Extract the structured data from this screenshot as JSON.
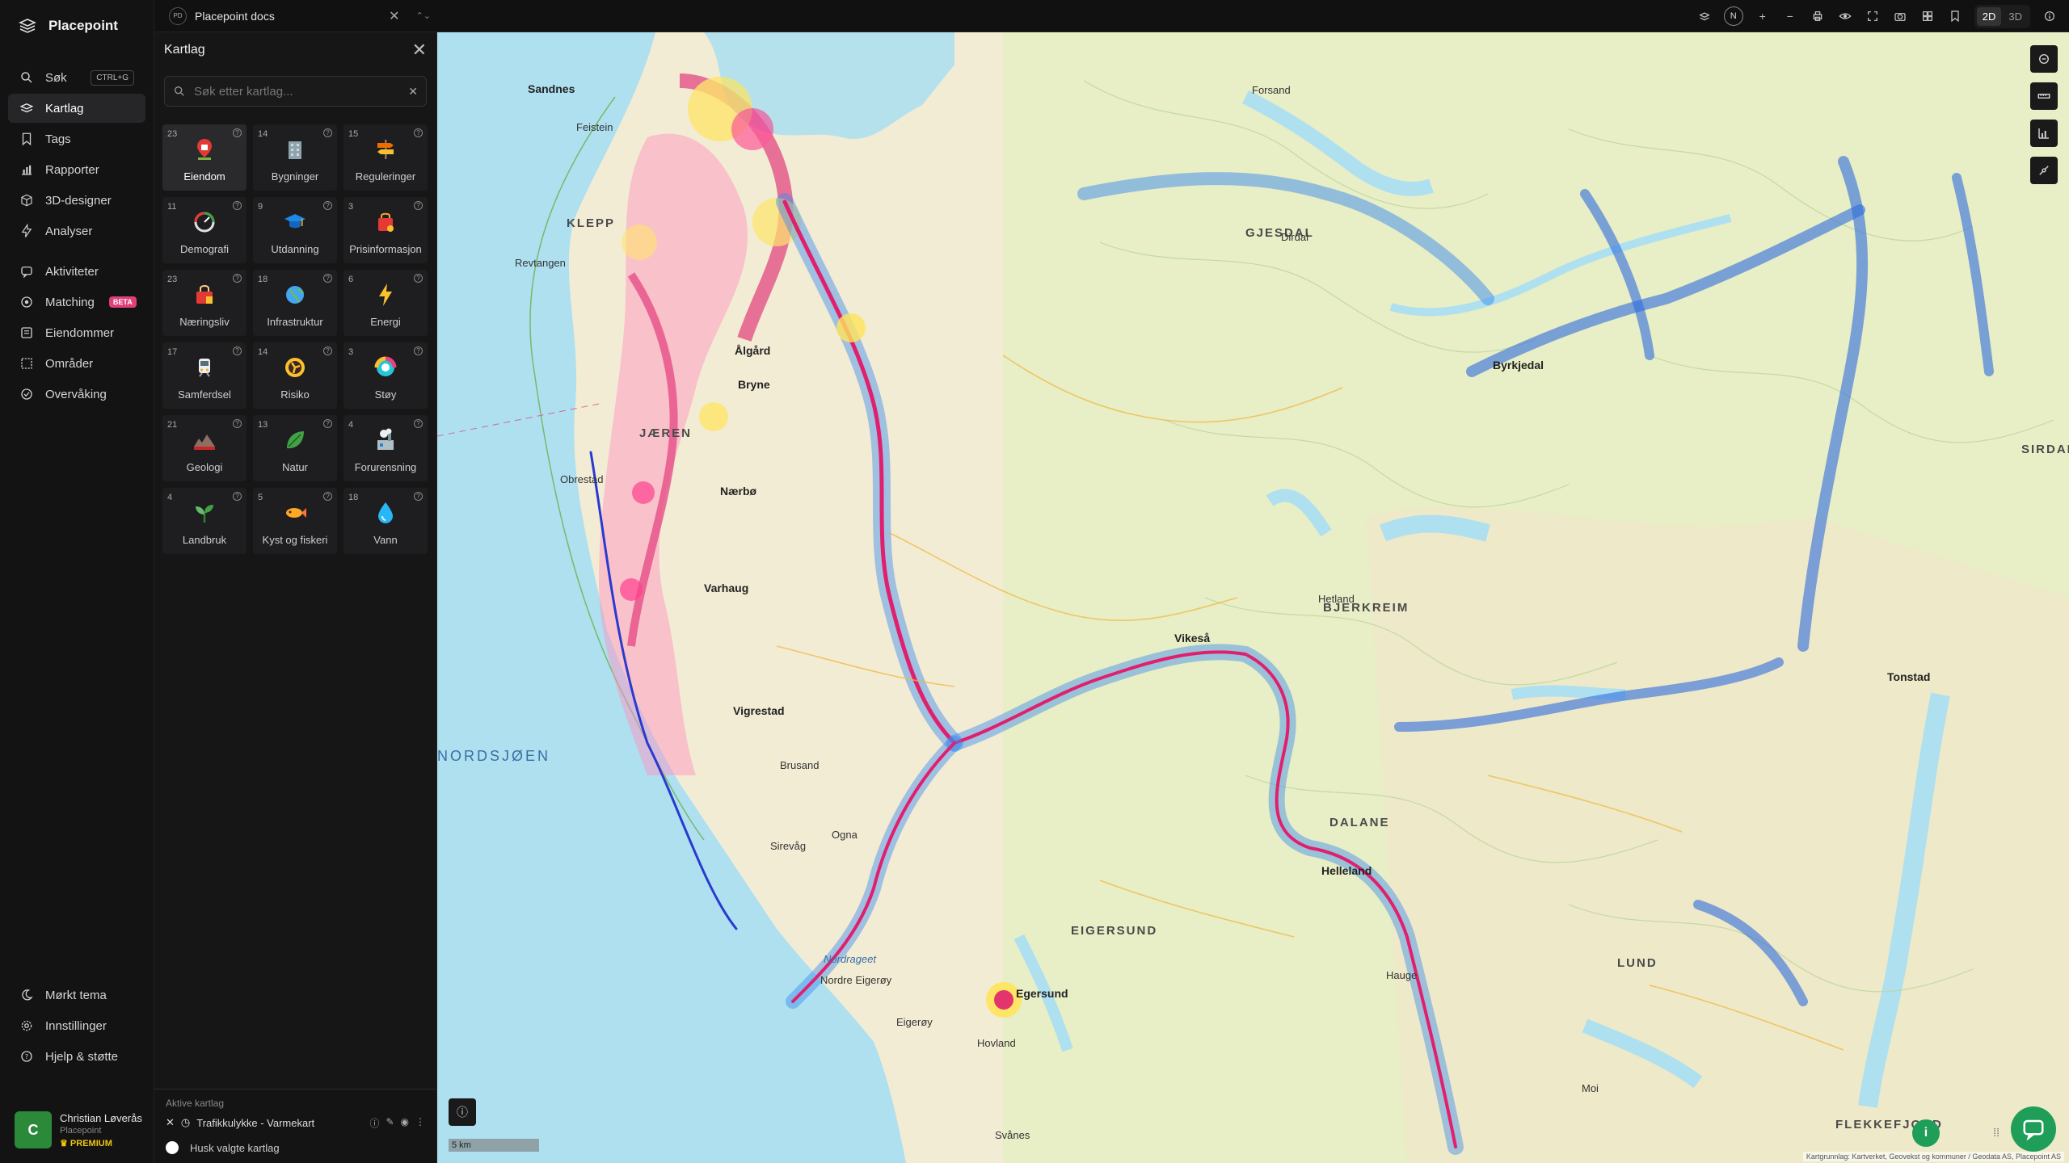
{
  "brand": {
    "name": "Placepoint"
  },
  "nav": {
    "primary": [
      {
        "label": "Søk",
        "shortcut": "CTRL+G"
      },
      {
        "label": "Kartlag"
      },
      {
        "label": "Tags"
      },
      {
        "label": "Rapporter"
      },
      {
        "label": "3D-designer"
      },
      {
        "label": "Analyser"
      }
    ],
    "secondary": [
      {
        "label": "Aktiviteter"
      },
      {
        "label": "Matching",
        "badge": "BETA"
      },
      {
        "label": "Eiendommer"
      },
      {
        "label": "Områder"
      },
      {
        "label": "Overvåking"
      }
    ],
    "bottom": [
      {
        "label": "Mørkt tema"
      },
      {
        "label": "Innstillinger"
      },
      {
        "label": "Hjelp & støtte"
      }
    ]
  },
  "user": {
    "initial": "C",
    "name": "Christian Løverås",
    "org": "Placepoint",
    "tier": "PREMIUM"
  },
  "topbar": {
    "doc_badge": "PD",
    "doc_title": "Placepoint docs",
    "compass": "N",
    "view_2d": "2D",
    "view_3d": "3D"
  },
  "panel": {
    "title": "Kartlag",
    "search_placeholder": "Søk etter kartlag...",
    "tiles": [
      {
        "count": "23",
        "label": "Eiendom",
        "icon": "pin-house-icon",
        "selected": true
      },
      {
        "count": "14",
        "label": "Bygninger",
        "icon": "building-icon"
      },
      {
        "count": "15",
        "label": "Reguleringer",
        "icon": "signpost-icon"
      },
      {
        "count": "11",
        "label": "Demografi",
        "icon": "gauge-icon"
      },
      {
        "count": "9",
        "label": "Utdanning",
        "icon": "graduation-cap-icon"
      },
      {
        "count": "3",
        "label": "Prisinformasjon",
        "icon": "shopping-bag-icon"
      },
      {
        "count": "23",
        "label": "Næringsliv",
        "icon": "shop-bag-icon"
      },
      {
        "count": "18",
        "label": "Infrastruktur",
        "icon": "globe-icon"
      },
      {
        "count": "6",
        "label": "Energi",
        "icon": "lightning-icon"
      },
      {
        "count": "17",
        "label": "Samferdsel",
        "icon": "train-icon"
      },
      {
        "count": "14",
        "label": "Risiko",
        "icon": "hazard-icon"
      },
      {
        "count": "3",
        "label": "Støy",
        "icon": "noise-dial-icon"
      },
      {
        "count": "21",
        "label": "Geologi",
        "icon": "terrain-icon"
      },
      {
        "count": "13",
        "label": "Natur",
        "icon": "leaf-icon"
      },
      {
        "count": "4",
        "label": "Forurensning",
        "icon": "factory-icon"
      },
      {
        "count": "4",
        "label": "Landbruk",
        "icon": "sprout-icon"
      },
      {
        "count": "5",
        "label": "Kyst og fiskeri",
        "icon": "fish-icon"
      },
      {
        "count": "18",
        "label": "Vann",
        "icon": "water-drop-icon"
      }
    ],
    "active_title": "Aktive kartlag",
    "active_layers": [
      {
        "label": "Trafikkulykke - Varmekart"
      }
    ],
    "remember_label": "Husk valgte kartlag"
  },
  "map": {
    "labels": {
      "sandnes": "Sandnes",
      "klepp": "KLEPP",
      "jaeren": "JÆREN",
      "bryne": "Bryne",
      "naerbo": "Nærbø",
      "varhaug": "Varhaug",
      "vigrestad": "Vigrestad",
      "brusand": "Brusand",
      "ogna": "Ogna",
      "egersund": "Egersund",
      "nordsjoen": "NORDSJØEN",
      "gjesdal": "GJESDAL",
      "bjerkreim": "BJERKREIM",
      "dalane": "DALANE",
      "eigersund": "EIGERSUND",
      "lund": "LUND",
      "sirdal": "SIRDAL",
      "flekkefjord": "FLEKKEFJORD",
      "algard": "Ålgård",
      "vikeså": "Vikeså",
      "helleland": "Helleland",
      "hauge": "Hauge",
      "moi": "Moi",
      "tonstad": "Tonstad",
      "forsand": "Forsand",
      "dirdal": "Dirdal",
      "byrkjedal": "Byrkjedal",
      "feistein": "Feistein",
      "revtangen": "Revtangen",
      "obrestad": "Obrestad",
      "sirevag": "Sirevåg",
      "hovland": "Hovland",
      "eigeroy": "Eigerøy",
      "nordre_eigeroy": "Nordre Eigerøy",
      "nordrageet": "Nordrageet",
      "svanes": "Svånes",
      "hetland": "Hetland"
    },
    "scale_label": "5 km",
    "attribution": "Kartgrunnlag: Kartverket, Geovekst og kommuner / Geodata AS, Placepoint AS",
    "colors": {
      "sea": "#aee0f0",
      "land": "#f3ecd4",
      "heat_hot": "#e0206e",
      "heat_mid": "#ff5fa8",
      "heat_cool": "#2f6de0"
    }
  }
}
